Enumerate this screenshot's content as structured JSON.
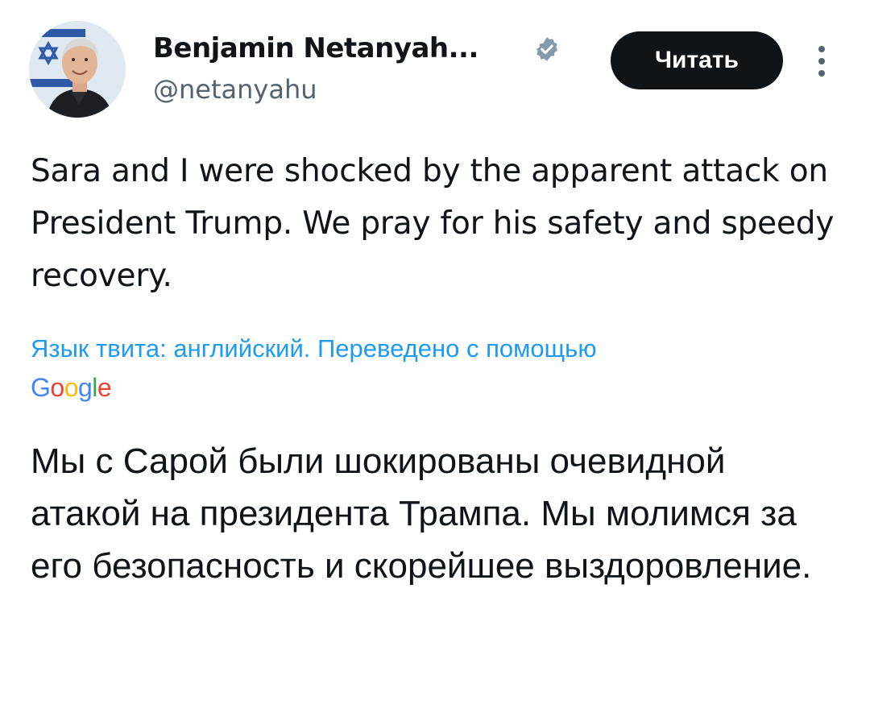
{
  "author": {
    "display_name": "Benjamin Netanyah...",
    "handle": "@netanyahu",
    "verified": true,
    "avatar_icon": "profile-photo"
  },
  "actions": {
    "follow_label": "Читать",
    "more_icon": "vertical-dots-icon"
  },
  "tweet": {
    "text": "Sara and I were shocked by the apparent attack on President Trump. We pray for his safety and speedy recovery.",
    "translation_note": "Язык твита: английский. Переведено с помощью",
    "translation_provider": "Google",
    "translated_text": "Мы с Сарой были шокированы очевидной атакой на президента Трампа. Мы молимся за его безопасность и скорейшее выздоровление."
  },
  "colors": {
    "text": "#0f1419",
    "secondary": "#536471",
    "link": "#1d9bf0",
    "verified": "#829aab",
    "button_bg": "#0f1419",
    "google_blue": "#4285f4",
    "google_red": "#ea4335",
    "google_yellow": "#fbbc05",
    "google_green": "#34a853"
  }
}
